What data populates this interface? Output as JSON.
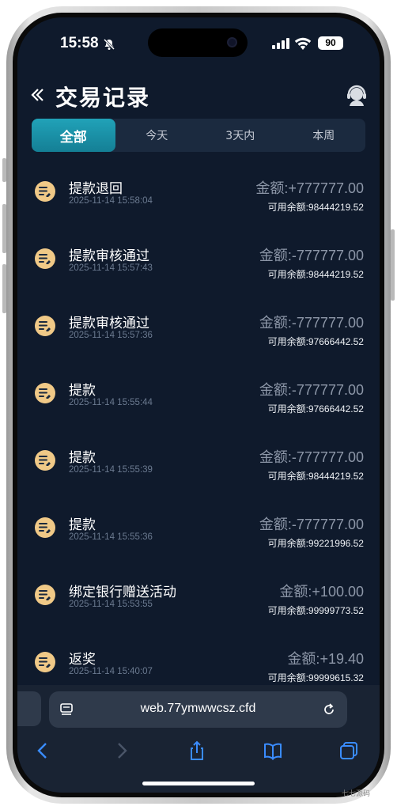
{
  "status": {
    "time": "15:58",
    "battery": "90"
  },
  "header": {
    "title": "交易记录"
  },
  "tabs": [
    {
      "label": "全部",
      "active": true
    },
    {
      "label": "今天",
      "active": false
    },
    {
      "label": "3天内",
      "active": false
    },
    {
      "label": "本周",
      "active": false
    }
  ],
  "records": [
    {
      "name": "提款退回",
      "time": "2025-11-14 15:58:04",
      "amount": "金额:+777777.00",
      "balance": "可用余额:98444219.52"
    },
    {
      "name": "提款审核通过",
      "time": "2025-11-14 15:57:43",
      "amount": "金额:-777777.00",
      "balance": "可用余额:98444219.52"
    },
    {
      "name": "提款审核通过",
      "time": "2025-11-14 15:57:36",
      "amount": "金额:-777777.00",
      "balance": "可用余额:97666442.52"
    },
    {
      "name": "提款",
      "time": "2025-11-14 15:55:44",
      "amount": "金额:-777777.00",
      "balance": "可用余额:97666442.52"
    },
    {
      "name": "提款",
      "time": "2025-11-14 15:55:39",
      "amount": "金额:-777777.00",
      "balance": "可用余额:98444219.52"
    },
    {
      "name": "提款",
      "time": "2025-11-14 15:55:36",
      "amount": "金额:-777777.00",
      "balance": "可用余额:99221996.52"
    },
    {
      "name": "绑定银行赠送活动",
      "time": "2025-11-14 15:53:55",
      "amount": "金额:+100.00",
      "balance": "可用余额:99999773.52"
    },
    {
      "name": "返奖",
      "time": "2025-11-14 15:40:07",
      "amount": "金额:+19.40",
      "balance": "可用余额:99999615.32"
    }
  ],
  "browser": {
    "url": "web.77ymwwcsz.cfd"
  },
  "watermark": "七七源码",
  "colors": {
    "background": "#0f1a2c",
    "accent": "#1a95ab",
    "icon": "#f0c987"
  }
}
